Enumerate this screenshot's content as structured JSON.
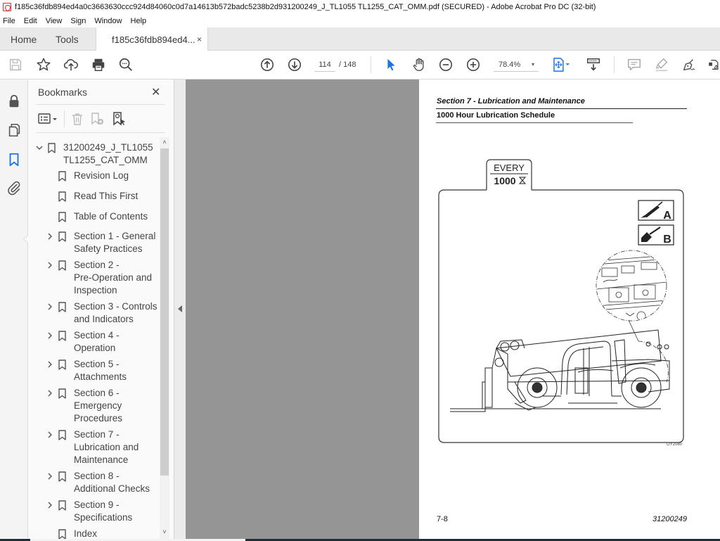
{
  "window": {
    "title": "f185c36fdb894ed4a0c3663630ccc924d84060c0d7a14613b572badc5238b2d931200249_J_TL1055 TL1255_CAT_OMM.pdf (SECURED) - Adobe Acrobat Pro DC (32-bit)"
  },
  "menu": [
    "File",
    "Edit",
    "View",
    "Sign",
    "Window",
    "Help"
  ],
  "tabs": {
    "home": "Home",
    "tools": "Tools",
    "document": "f185c36fdb894ed4...",
    "close": "×"
  },
  "toolbar": {
    "current_page": "114",
    "total_pages": "/ 148",
    "zoom": "78.4%",
    "zoom_caret": "▾",
    "icons": [
      "save-icon",
      "bookmark-star-icon",
      "upload-cloud-icon",
      "print-icon",
      "search-zoom-icon",
      "prev-page-icon",
      "next-page-icon",
      "select-cursor-icon",
      "hand-icon",
      "zoom-out-icon",
      "zoom-in-icon",
      "page-fit-icon",
      "scroll-mode-icon",
      "comment-icon",
      "highlight-icon",
      "sign-icon",
      "more-tools-icon"
    ]
  },
  "left_rail": {
    "icons": [
      "lock-icon",
      "pages-icon",
      "bookmarks-icon",
      "attachment-icon"
    ],
    "active": "bookmarks-icon"
  },
  "bookmarks": {
    "header": "Bookmarks",
    "close": "✕",
    "tools": [
      "options-menu-icon",
      "delete-bookmark-icon",
      "new-bookmark-icon",
      "find-bookmark-icon"
    ],
    "items": [
      {
        "label": "31200249_J_TL1055\nTL1255_CAT_OMM",
        "expanded": true,
        "level": 0,
        "has_children": true
      },
      {
        "label": "Revision Log",
        "level": 1,
        "has_children": false
      },
      {
        "label": "Read This First",
        "level": 1,
        "has_children": false
      },
      {
        "label": "Table of Contents",
        "level": 1,
        "has_children": false
      },
      {
        "label": "Section 1 - General\nSafety Practices",
        "level": 1,
        "has_children": true
      },
      {
        "label": "Section 2 -\nPre-Operation and\nInspection",
        "level": 1,
        "has_children": true
      },
      {
        "label": "Section 3 - Controls\nand Indicators",
        "level": 1,
        "has_children": true
      },
      {
        "label": "Section 4 -\nOperation",
        "level": 1,
        "has_children": true
      },
      {
        "label": "Section 5 -\nAttachments",
        "level": 1,
        "has_children": true
      },
      {
        "label": "Section 6 -\nEmergency\nProcedures",
        "level": 1,
        "has_children": true
      },
      {
        "label": "Section 7 -\nLubrication and\nMaintenance",
        "level": 1,
        "has_children": true
      },
      {
        "label": "Section 8 -\nAdditional Checks",
        "level": 1,
        "has_children": true
      },
      {
        "label": "Section 9 -\nSpecifications",
        "level": 1,
        "has_children": true
      },
      {
        "label": "Index",
        "level": 1,
        "has_children": false
      }
    ],
    "scroll_up": "˄",
    "scroll_down": "˅"
  },
  "page": {
    "section_title": "Section 7 - Lubrication and Maintenance",
    "subtitle": "1000 Hour Lubrication Schedule",
    "badge_top": "EVERY",
    "badge_bottom": "1000",
    "legend_a": "A",
    "legend_b": "B",
    "figure_id": "OY2080",
    "footer_left": "7-8",
    "footer_right": "31200249"
  },
  "colors": {
    "accent_blue": "#1a73e8",
    "doc_background": "#959595",
    "panel_background": "#fafafa"
  }
}
